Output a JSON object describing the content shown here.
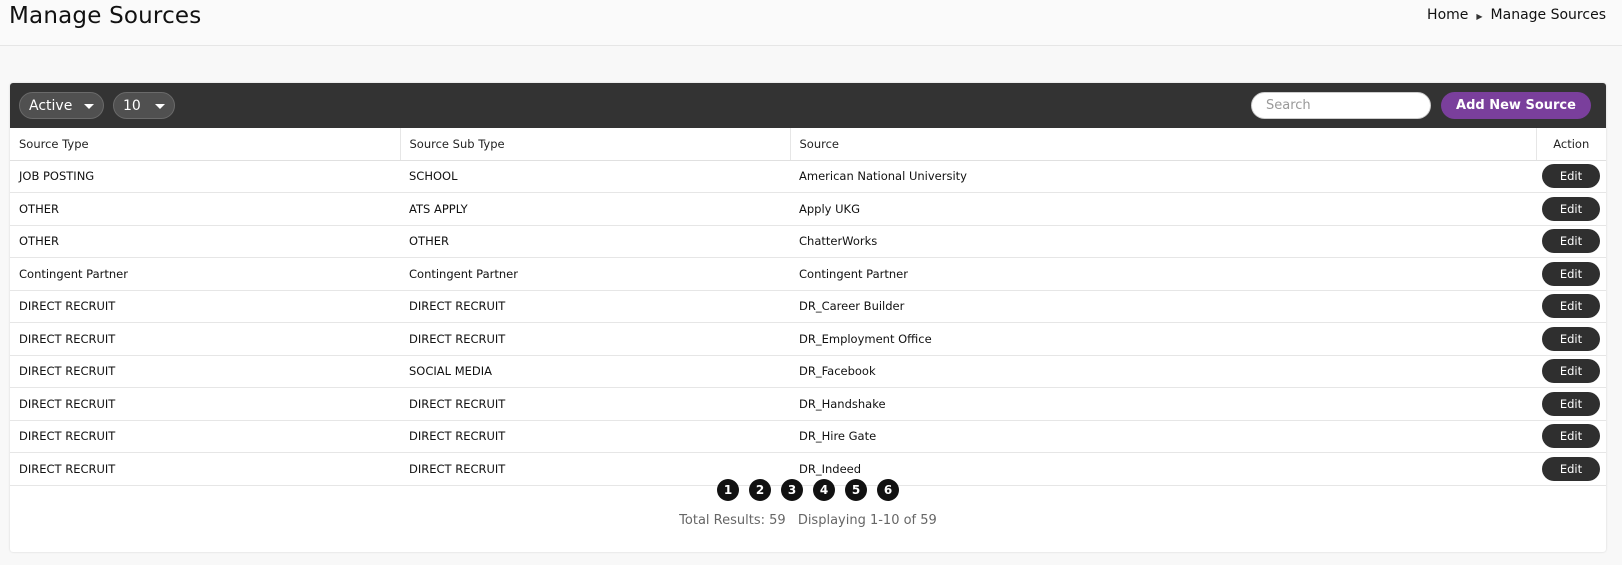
{
  "page": {
    "title": "Manage Sources"
  },
  "breadcrumb": {
    "home": "Home",
    "current": "Manage Sources"
  },
  "toolbar": {
    "status_value": "Active",
    "count_value": "10",
    "search_placeholder": "Search",
    "add_label": "Add New Source",
    "add_color": "#7a3f9c"
  },
  "table": {
    "headers": [
      "Source Type",
      "Source Sub Type",
      "Source",
      "Action"
    ],
    "rows": [
      {
        "type": "JOB POSTING",
        "subtype": "SCHOOL",
        "source": "American National University",
        "action": "Edit"
      },
      {
        "type": "OTHER",
        "subtype": "ATS APPLY",
        "source": "Apply UKG",
        "action": "Edit"
      },
      {
        "type": "OTHER",
        "subtype": "OTHER",
        "source": "ChatterWorks",
        "action": "Edit"
      },
      {
        "type": "Contingent Partner",
        "subtype": "Contingent Partner",
        "source": "Contingent Partner",
        "action": "Edit"
      },
      {
        "type": "DIRECT RECRUIT",
        "subtype": "DIRECT RECRUIT",
        "source": "DR_Career Builder",
        "action": "Edit"
      },
      {
        "type": "DIRECT RECRUIT",
        "subtype": "DIRECT RECRUIT",
        "source": "DR_Employment Office",
        "action": "Edit"
      },
      {
        "type": "DIRECT RECRUIT",
        "subtype": "SOCIAL MEDIA",
        "source": "DR_Facebook",
        "action": "Edit"
      },
      {
        "type": "DIRECT RECRUIT",
        "subtype": "DIRECT RECRUIT",
        "source": "DR_Handshake",
        "action": "Edit"
      },
      {
        "type": "DIRECT RECRUIT",
        "subtype": "DIRECT RECRUIT",
        "source": "DR_Hire Gate",
        "action": "Edit"
      },
      {
        "type": "DIRECT RECRUIT",
        "subtype": "DIRECT RECRUIT",
        "source": "DR_Indeed",
        "action": "Edit"
      }
    ]
  },
  "pagination": {
    "pages": [
      "1",
      "2",
      "3",
      "4",
      "5",
      "6"
    ],
    "total_text": "Total Results: 59",
    "display_text": "Displaying 1-10 of 59"
  }
}
